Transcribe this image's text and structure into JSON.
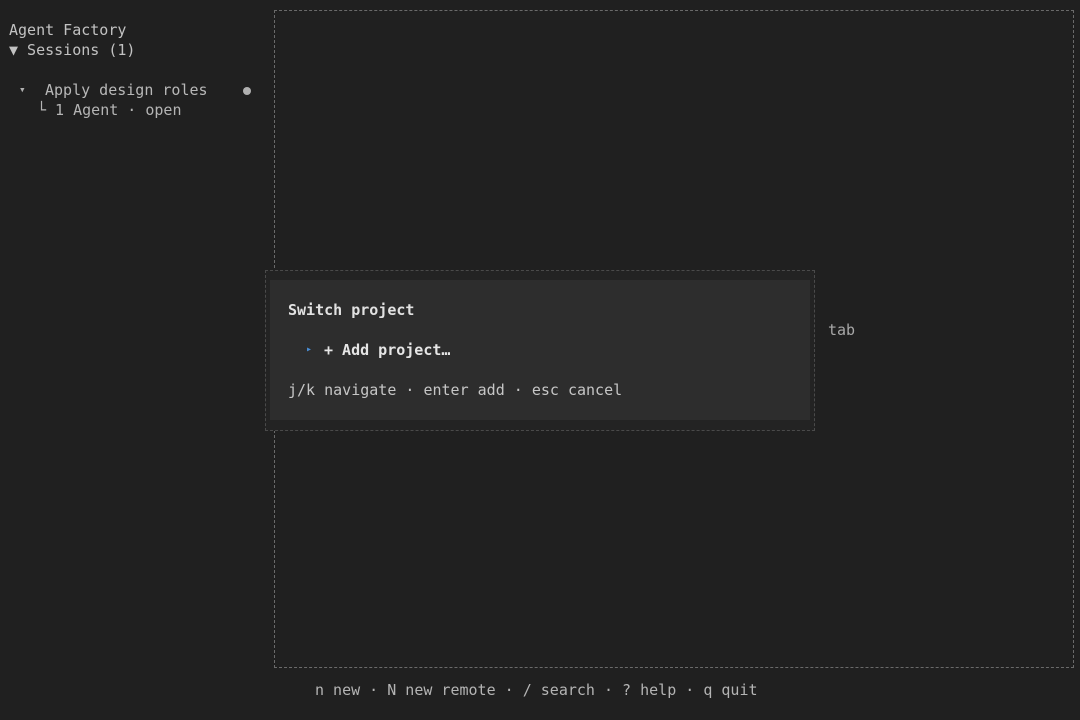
{
  "app": {
    "title": "Agent Factory"
  },
  "sidebar": {
    "sessions_header": "▼ Sessions (1)",
    "sessions": [
      {
        "caret": "▾",
        "title": "Apply design roles",
        "status_icon": "status-dot-icon",
        "subtitle": "└ 1 Agent · open"
      }
    ]
  },
  "main": {
    "tab_label": "tab"
  },
  "modal": {
    "title": "Switch project",
    "options": [
      {
        "arrow": "▸",
        "label": "+ Add project…",
        "selected": true
      }
    ],
    "hint": "j/k navigate · enter add · esc cancel"
  },
  "footer": {
    "hint": "n new · N new remote · / search · ? help · q quit"
  },
  "colors": {
    "background": "#202020",
    "modal_background": "#2d2d2d",
    "accent_arrow": "#4a90d9",
    "text": "#b4b4b4"
  }
}
